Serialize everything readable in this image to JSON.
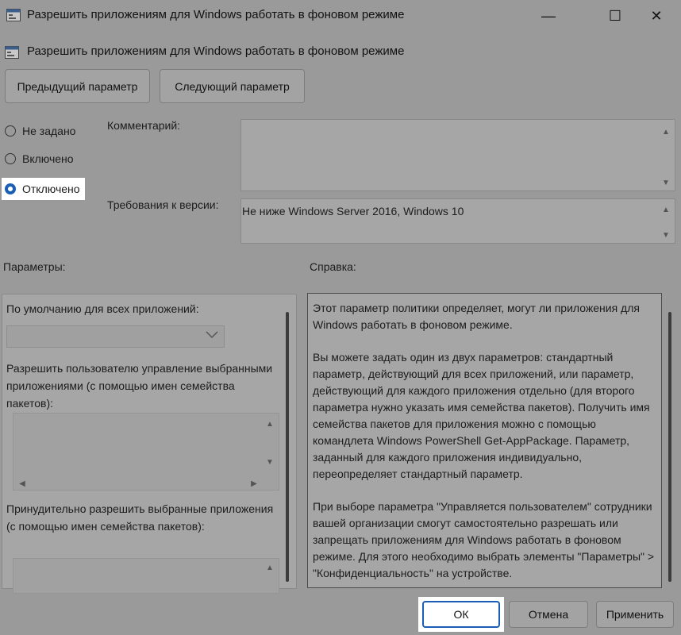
{
  "window": {
    "title": "Разрешить приложениям для Windows работать в фоновом режиме",
    "minimize_glyph": "—",
    "maximize_glyph": "☐",
    "close_glyph": "✕"
  },
  "header": {
    "policy_title": "Разрешить приложениям для Windows работать в фоновом режиме",
    "prev_label": "Предыдущий параметр",
    "next_label": "Следующий параметр"
  },
  "state": {
    "options": [
      "Не задано",
      "Включено",
      "Отключено"
    ],
    "selected": "Отключено"
  },
  "fields": {
    "comment_label": "Комментарий:",
    "comment_value": "",
    "version_label": "Требования к версии:",
    "version_value": "Не ниже Windows Server 2016, Windows 10"
  },
  "params": {
    "label": "Параметры:",
    "default_label": "По умолчанию для всех приложений:",
    "default_value": "",
    "manage_label": "Разрешить пользователю управление выбранными приложениями (с помощью имен семейства пакетов):",
    "force_label": "Принудительно разрешить выбранные приложения (с помощью имен семейства пакетов):"
  },
  "help": {
    "label": "Справка:",
    "paragraphs": [
      "Этот параметр политики определяет, могут ли приложения для Windows работать в фоновом режиме.",
      "Вы можете задать один из двух параметров: стандартный параметр, действующий для всех приложений, или параметр, действующий для каждого приложения отдельно (для второго параметра нужно указать имя семейства пакетов). Получить имя семейства пакетов для приложения можно с помощью командлета Windows PowerShell Get-AppPackage. Параметр, заданный для каждого приложения индивидуально, переопределяет стандартный параметр.",
      "При выборе параметра \"Управляется пользователем\" сотрудники вашей организации смогут самостоятельно разрешать или запрещать приложениям для Windows работать в фоновом режиме. Для этого необходимо выбрать элементы \"Параметры\" > \"Конфиденциальность\" на устройстве."
    ]
  },
  "footer": {
    "ok_label": "ОК",
    "cancel_label": "Отмена",
    "apply_label": "Применить"
  },
  "colors": {
    "accent": "#1a5fb4",
    "dim_background": "#9a9a9a"
  }
}
